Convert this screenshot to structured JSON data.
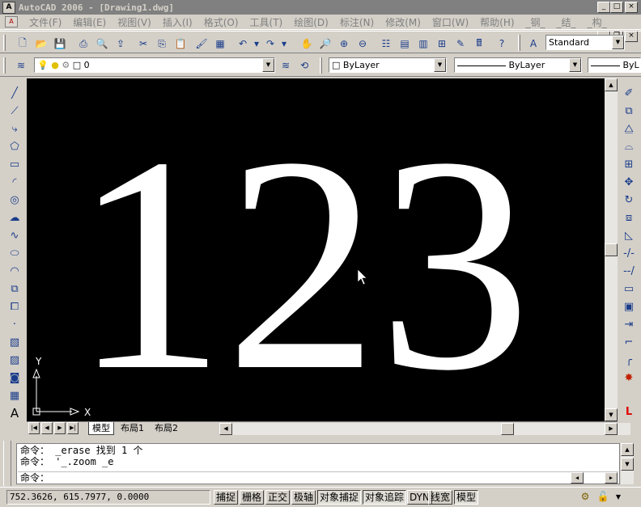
{
  "window": {
    "title": "AutoCAD 2006 - [Drawing1.dwg]",
    "app_icon": "A",
    "min": "_",
    "max": "□",
    "close": "×"
  },
  "menu": [
    "文件(F)",
    "编辑(E)",
    "视图(V)",
    "插入(I)",
    "格式(O)",
    "工具(T)",
    "绘图(D)",
    "标注(N)",
    "修改(M)",
    "窗口(W)",
    "帮助(H)",
    "_钢_",
    "_结_",
    "_构_"
  ],
  "mdi": {
    "min": "_",
    "restore": "❐",
    "close": "×"
  },
  "toolbar": {
    "text_style": "Standard"
  },
  "layers": {
    "current_layer": "0",
    "color": "ByLayer",
    "linetype": "ByLayer",
    "lineweight": "ByL"
  },
  "drawing": {
    "text": "123",
    "color": "#ffffff",
    "background": "#000000"
  },
  "ucs": {
    "x_label": "X",
    "y_label": "Y"
  },
  "tabs": {
    "model": "模型",
    "layout1": "布局1",
    "layout2": "布局2"
  },
  "command": {
    "line1": "命令： _erase 找到 1 个",
    "line2": "命令： '_.zoom _e",
    "prompt": "命令："
  },
  "status": {
    "coords": "752.3626, 615.7977, 0.0000",
    "buttons": [
      "捕捉",
      "栅格",
      "正交",
      "极轴",
      "对象捕捉",
      "对象追踪",
      "DYN",
      "线宽",
      "模型"
    ]
  }
}
